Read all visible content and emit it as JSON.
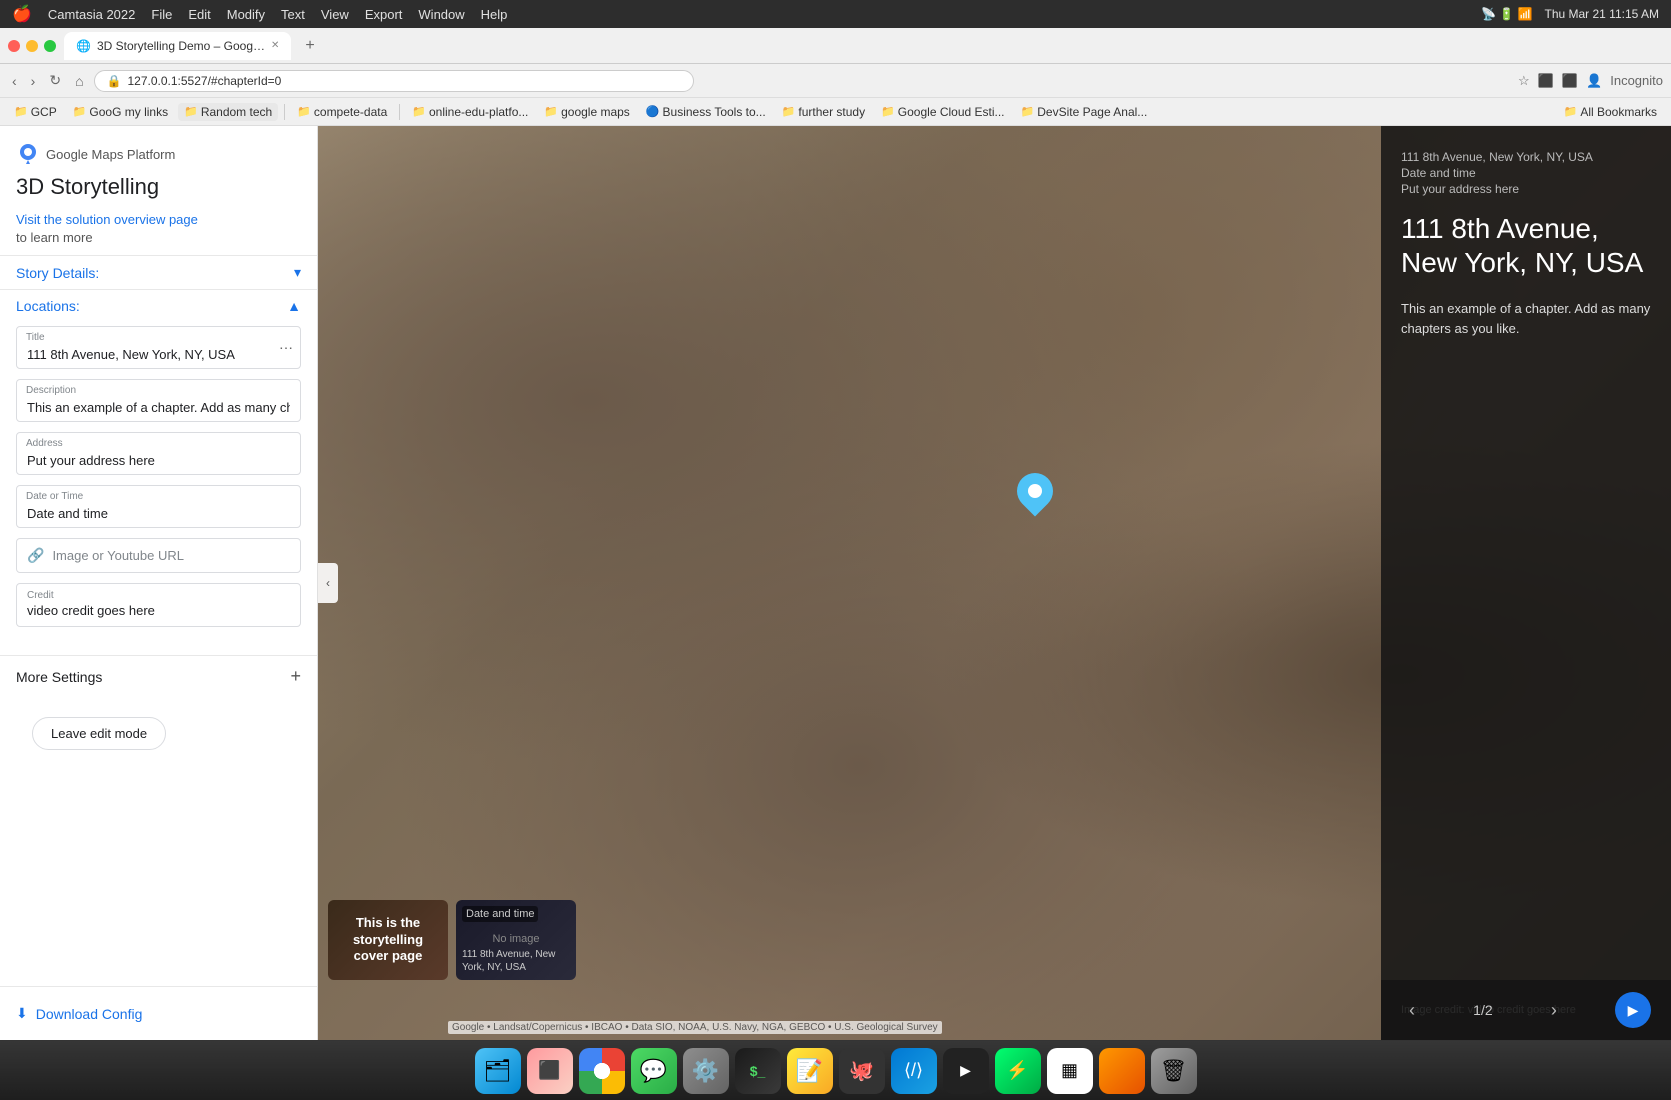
{
  "macbar": {
    "apple": "🍎",
    "app_name": "Camtasia 2022",
    "menus": [
      "File",
      "Edit",
      "Modify",
      "Text",
      "View",
      "Export",
      "Window",
      "Help"
    ],
    "time": "Thu Mar 21  11:15 AM"
  },
  "browser": {
    "tab_title": "3D Storytelling Demo – Goog…",
    "tab_favicon": "🌐",
    "address": "127.0.0.1:5527/#chapterId=0",
    "new_tab_label": "+"
  },
  "bookmarks": [
    {
      "label": "GCP",
      "icon": "📁"
    },
    {
      "label": "GooG my links",
      "icon": "📁"
    },
    {
      "label": "Random tech",
      "icon": "📁",
      "active": true
    },
    {
      "label": "compete-data",
      "icon": "📁"
    },
    {
      "label": "",
      "icon": "✖",
      "is_close": true
    },
    {
      "label": "online-edu-platfo...",
      "icon": "📁"
    },
    {
      "label": "google maps",
      "icon": "📁"
    },
    {
      "label": "Business Tools to...",
      "icon": "🔵"
    },
    {
      "label": "further study",
      "icon": "📁"
    },
    {
      "label": "Google Cloud Esti...",
      "icon": "📁"
    },
    {
      "label": "DevSite Page Anal...",
      "icon": "📁"
    },
    {
      "label": "All Bookmarks",
      "icon": "📁"
    }
  ],
  "left_panel": {
    "maps_platform_label": "Google Maps Platform",
    "title": "3D Storytelling",
    "visit_link": "Visit the solution overview page",
    "learn_more": "to learn more",
    "story_details_label": "Story Details:",
    "locations_label": "Locations:",
    "form": {
      "title_label": "Title",
      "title_value": "111 8th Avenue, New York, NY, USA",
      "description_label": "Description",
      "description_value": "This an example of a chapter. Add as many chapte",
      "address_label": "Address",
      "address_value": "Put your address here",
      "date_time_label": "Date or Time",
      "date_time_value": "Date and time",
      "url_label": "Image or Youtube URL",
      "url_icon": "🔗",
      "credit_label": "Credit",
      "credit_value": "video credit goes here"
    },
    "more_settings_label": "More Settings",
    "leave_edit_label": "Leave edit mode",
    "download_config_label": "Download Config",
    "download_icon": "⬇"
  },
  "map": {
    "pin_location": "marker"
  },
  "info_overlay": {
    "location_label": "111 8th Avenue, New York, NY, USA",
    "date_label": "Date and time",
    "address_label": "Put your address here",
    "address_large": "111 8th Avenue, New York, NY, USA",
    "description": "This an example of a chapter. Add as many chapters as you like.",
    "image_credit": "Image credit: video credit goes here"
  },
  "nav_controls": {
    "prev_icon": "‹",
    "page_indicator": "1/2",
    "next_icon": "›",
    "play_icon": "▶"
  },
  "thumbnails": [
    {
      "id": 1,
      "label": "This is the storytelling cover page",
      "type": "cover"
    },
    {
      "id": 2,
      "top_label": "Date and time",
      "no_image": "No image",
      "address": "111 8th Avenue, New York, NY, USA",
      "type": "location"
    }
  ],
  "google_attribution": "Google • Landsat/Copernicus • IBCAO • Data SIO, NOAA, U.S. Navy, NGA, GEBCO • U.S. Geological Survey",
  "dock": {
    "icons": [
      {
        "name": "finder",
        "emoji": "😊"
      },
      {
        "name": "launchpad",
        "emoji": "🚀"
      },
      {
        "name": "chrome",
        "emoji": ""
      },
      {
        "name": "messages",
        "emoji": "💬"
      },
      {
        "name": "settings",
        "emoji": "⚙️"
      },
      {
        "name": "terminal",
        "emoji": "$"
      },
      {
        "name": "notes",
        "emoji": "📝"
      },
      {
        "name": "github",
        "emoji": "🐙"
      },
      {
        "name": "vscode",
        "emoji": "📘"
      },
      {
        "name": "unity",
        "emoji": "🎮"
      },
      {
        "name": "warp",
        "emoji": "⚡"
      },
      {
        "name": "qr",
        "emoji": "▦"
      },
      {
        "name": "orange-app",
        "emoji": "🟠"
      },
      {
        "name": "trash",
        "emoji": "🗑"
      }
    ]
  }
}
